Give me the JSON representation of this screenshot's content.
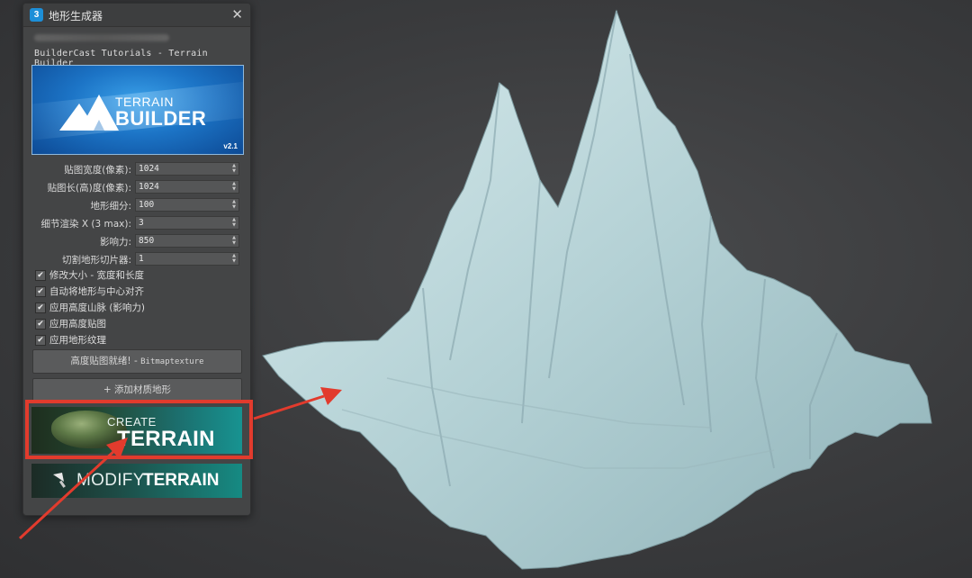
{
  "window": {
    "app_icon_text": "3",
    "title": "地形生成器",
    "close_label": "✕",
    "subtitle": "BuilderCast Tutorials - Terrain Builder"
  },
  "banner": {
    "logo_line1": "TERRAIN",
    "logo_line2": "BUILDER",
    "version": "v2.1"
  },
  "fields": [
    {
      "label": "贴图宽度(像素):",
      "value": "1024"
    },
    {
      "label": "贴图长(高)度(像素):",
      "value": "1024"
    },
    {
      "label": "地形细分:",
      "value": "100"
    },
    {
      "label": "细节渲染 X (3 max):",
      "value": "3"
    },
    {
      "label": "影响力:",
      "value": "850"
    },
    {
      "label": "切割地形切片器:",
      "value": "1"
    }
  ],
  "checkboxes": [
    {
      "label": "修改大小 - 宽度和长度",
      "checked": "✔"
    },
    {
      "label": "自动将地形与中心对齐",
      "checked": "✔"
    },
    {
      "label": "应用高度山脉 (影响力)",
      "checked": "✔"
    },
    {
      "label": "应用高度贴图",
      "checked": "✔"
    },
    {
      "label": "应用地形纹理",
      "checked": "✔"
    }
  ],
  "buttons": {
    "heightmap_ready_prefix": "高度贴图就绪! - ",
    "heightmap_ready_suffix": "Bitmaptexture",
    "add_material": "+ 添加材质地形",
    "create_word": "CREATE",
    "create_terrain_word": "TERRAIN",
    "modify_word": "MODIFY",
    "modify_terrain_word": "TERRAIN"
  },
  "colors": {
    "panel_bg": "#444546",
    "highlight_red": "#e23b2d",
    "terrain_mesh": "#bfd9dc",
    "viewport_bg": "#3a3b3d"
  }
}
